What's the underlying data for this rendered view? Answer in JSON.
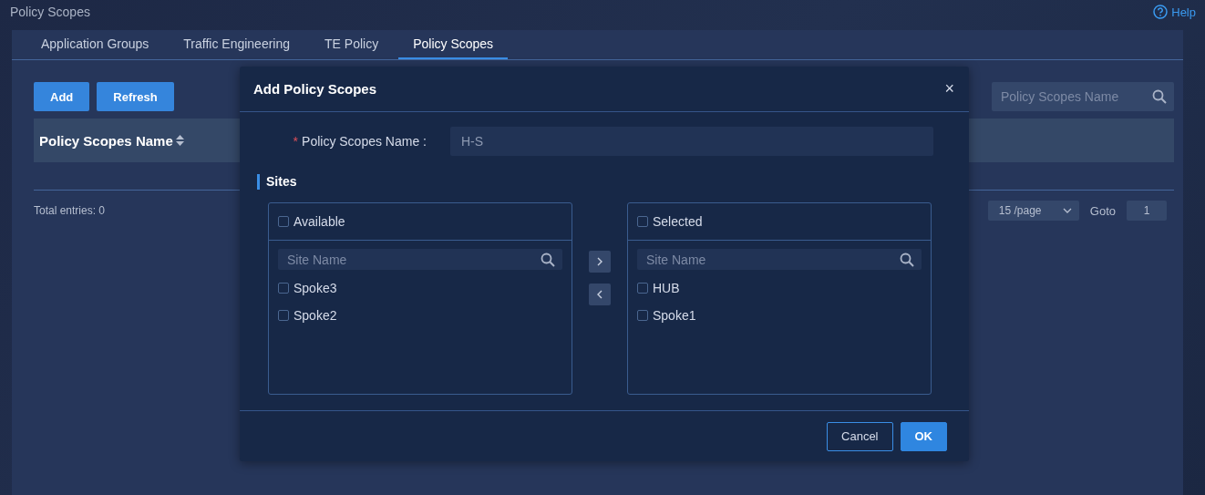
{
  "page": {
    "title": "Policy Scopes",
    "help": "Help"
  },
  "tabs": [
    {
      "label": "Application Groups",
      "selected": false
    },
    {
      "label": "Traffic Engineering",
      "selected": false
    },
    {
      "label": "TE Policy",
      "selected": false
    },
    {
      "label": "Policy Scopes",
      "selected": true
    }
  ],
  "toolbar": {
    "buttons": [
      "Add",
      "Refresh"
    ],
    "search": {
      "placeholder": "Policy Scopes Name"
    }
  },
  "table": {
    "columns": [
      {
        "label": "Policy Scopes Name",
        "sortable": true
      }
    ]
  },
  "footer": {
    "total": "Total entries: 0",
    "page_size": "15 /page",
    "goto_label": "Goto",
    "goto_value": "1"
  },
  "dialog": {
    "title": "Add Policy Scopes",
    "close": "×",
    "field": {
      "label": "Policy Scopes Name :",
      "required_mark": "*",
      "value": "H-S"
    },
    "section": "Sites",
    "lists": [
      {
        "title": "Available",
        "checked": false,
        "search_placeholder": "Site Name",
        "items": [
          {
            "label": "Spoke3",
            "checked": false
          },
          {
            "label": "Spoke2",
            "checked": false
          }
        ]
      },
      {
        "title": "Selected",
        "checked": false,
        "search_placeholder": "Site Name",
        "items": [
          {
            "label": "HUB",
            "checked": false
          },
          {
            "label": "Spoke1",
            "checked": false
          }
        ]
      }
    ],
    "buttons": [
      {
        "label": "Cancel",
        "kind": "secondary"
      },
      {
        "label": "OK",
        "kind": "primary"
      }
    ]
  }
}
